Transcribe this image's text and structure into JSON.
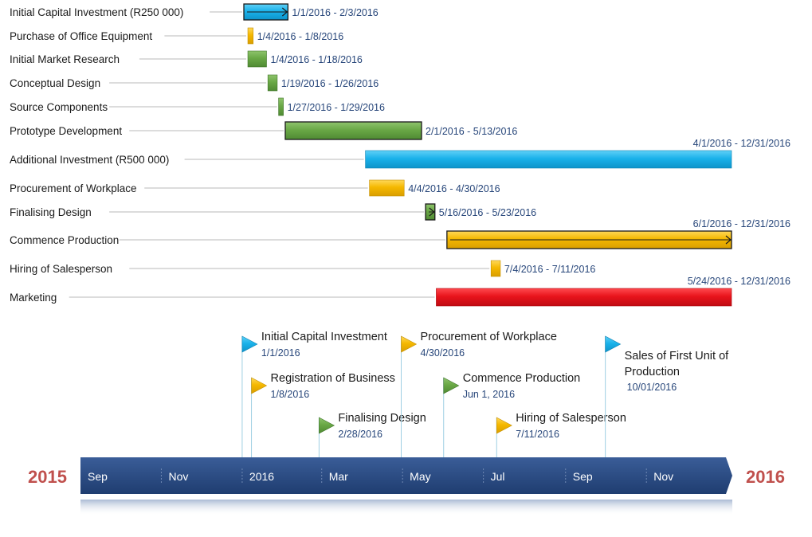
{
  "colors": {
    "blue": "#1ab2ea",
    "yellow": "#f5b800",
    "green": "#6aa846",
    "red": "#e8141c",
    "axis": "#27467a",
    "year_text": "#c0504d",
    "date_text": "#27467a"
  },
  "tasks": [
    {
      "label": "Initial Capital Investment (R250 000)",
      "dates": "1/1/2016  - 2/3/2016",
      "start": "2016-01-01",
      "end": "2016-02-03",
      "color": "blue",
      "outlined": true,
      "arrow": true
    },
    {
      "label": "Purchase of Office Equipment",
      "dates": "1/4/2016  - 1/8/2016",
      "start": "2016-01-04",
      "end": "2016-01-08",
      "color": "yellow"
    },
    {
      "label": "Initial Market Research",
      "dates": "1/4/2016  - 1/18/2016",
      "start": "2016-01-04",
      "end": "2016-01-18",
      "color": "green"
    },
    {
      "label": "Conceptual Design",
      "dates": "1/19/2016  - 1/26/2016",
      "start": "2016-01-19",
      "end": "2016-01-26",
      "color": "green"
    },
    {
      "label": "Source Components",
      "dates": "1/27/2016  - 1/29/2016",
      "start": "2016-01-27",
      "end": "2016-01-29",
      "color": "green"
    },
    {
      "label": "Prototype Development",
      "dates": "2/1/2016  - 5/13/2016",
      "start": "2016-02-01",
      "end": "2016-05-13",
      "color": "green",
      "outlined": true
    },
    {
      "label": "Additional Investment (R500 000)",
      "dates": "4/1/2016  - 12/31/2016",
      "start": "2016-04-01",
      "end": "2016-12-31",
      "color": "blue",
      "date_above": true
    },
    {
      "label": "Procurement of Workplace",
      "dates": "4/4/2016  - 4/30/2016",
      "start": "2016-04-04",
      "end": "2016-04-30",
      "color": "yellow"
    },
    {
      "label": "Finalising Design",
      "dates": "5/16/2016  - 5/23/2016",
      "start": "2016-05-16",
      "end": "2016-05-23",
      "color": "green",
      "outlined": true,
      "arrow": true
    },
    {
      "label": "Commence Production",
      "dates": "6/1/2016  - 12/31/2016",
      "start": "2016-06-01",
      "end": "2016-12-31",
      "color": "yellow",
      "outlined": true,
      "arrow": true,
      "date_above": true
    },
    {
      "label": "Hiring of Salesperson",
      "dates": "7/4/2016  - 7/11/2016",
      "start": "2016-07-04",
      "end": "2016-07-11",
      "color": "yellow"
    },
    {
      "label": "Marketing",
      "dates": "5/24/2016  - 12/31/2016",
      "start": "2016-05-24",
      "end": "2016-12-31",
      "color": "red",
      "date_above": true
    }
  ],
  "milestones": [
    {
      "title": "Initial Capital Investment",
      "date": "1/1/2016",
      "at": "2016-01-01",
      "color": "blue",
      "level": 0
    },
    {
      "title": "Registration of Business",
      "date": "1/8/2016",
      "at": "2016-01-08",
      "color": "yellow",
      "level": 1
    },
    {
      "title": "Finalising Design",
      "date": "2/28/2016",
      "at": "2016-02-28",
      "color": "green",
      "level": 2
    },
    {
      "title": "Procurement of Workplace",
      "date": "4/30/2016",
      "at": "2016-04-30",
      "color": "yellow",
      "level": 0
    },
    {
      "title": "Commence Production",
      "date": "Jun 1, 2016",
      "at": "2016-06-01",
      "color": "green",
      "level": 1
    },
    {
      "title": "Hiring of Salesperson",
      "date": "7/11/2016",
      "at": "2016-07-11",
      "color": "yellow",
      "level": 2
    },
    {
      "title": [
        "Sales of First Unit of",
        "Production"
      ],
      "date": "10/01/2016",
      "at": "2016-10-01",
      "color": "blue",
      "level": 0
    }
  ],
  "axis": {
    "start": "2015-09-01",
    "end": "2016-12-31",
    "year_left": "2015",
    "year_right": "2016",
    "months": [
      {
        "label": "Sep",
        "at": "2015-09-01"
      },
      {
        "label": "Nov",
        "at": "2015-11-01"
      },
      {
        "label": "2016",
        "at": "2016-01-01"
      },
      {
        "label": "Mar",
        "at": "2016-03-01"
      },
      {
        "label": "May",
        "at": "2016-05-01"
      },
      {
        "label": "Jul",
        "at": "2016-07-01"
      },
      {
        "label": "Sep",
        "at": "2016-09-01"
      },
      {
        "label": "Nov",
        "at": "2016-11-01"
      }
    ]
  }
}
